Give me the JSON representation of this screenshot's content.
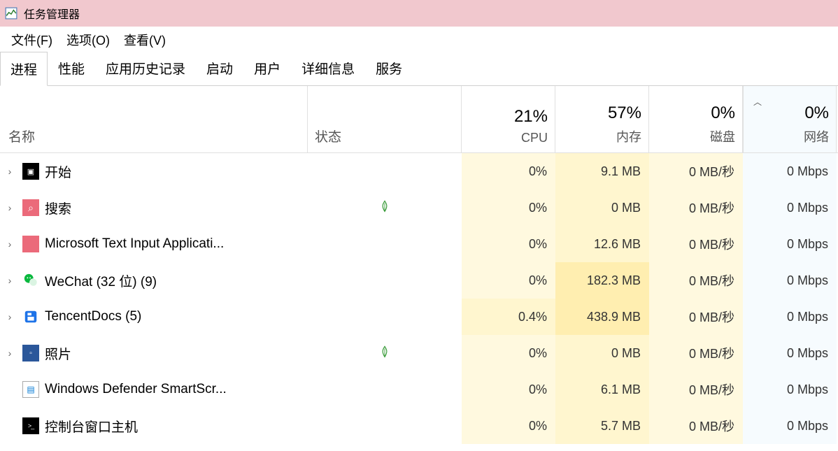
{
  "window": {
    "title": "任务管理器"
  },
  "menu": {
    "file": "文件(F)",
    "options": "选项(O)",
    "view": "查看(V)"
  },
  "tabs": {
    "processes": "进程",
    "performance": "性能",
    "app_history": "应用历史记录",
    "startup": "启动",
    "users": "用户",
    "details": "详细信息",
    "services": "服务"
  },
  "headers": {
    "name": "名称",
    "status": "状态",
    "cpu_pct": "21%",
    "cpu_label": "CPU",
    "mem_pct": "57%",
    "mem_label": "内存",
    "disk_pct": "0%",
    "disk_label": "磁盘",
    "net_pct": "0%",
    "net_label": "网络"
  },
  "rows": [
    {
      "expandable": true,
      "icon": "black",
      "name": "开始",
      "leaf": false,
      "cpu": "0%",
      "mem": "9.1 MB",
      "disk": "0 MB/秒",
      "net": "0 Mbps",
      "mem_shade": "shade-low"
    },
    {
      "expandable": true,
      "icon": "pink",
      "name": "搜索",
      "leaf": true,
      "cpu": "0%",
      "mem": "0 MB",
      "disk": "0 MB/秒",
      "net": "0 Mbps",
      "mem_shade": "shade-low"
    },
    {
      "expandable": true,
      "icon": "pink2",
      "name": "Microsoft Text Input Applicati...",
      "leaf": false,
      "cpu": "0%",
      "mem": "12.6 MB",
      "disk": "0 MB/秒",
      "net": "0 Mbps",
      "mem_shade": "shade-low"
    },
    {
      "expandable": true,
      "icon": "wechat",
      "name": "WeChat (32 位) (9)",
      "leaf": false,
      "cpu": "0%",
      "mem": "182.3 MB",
      "disk": "0 MB/秒",
      "net": "0 Mbps",
      "mem_shade": "shade-med"
    },
    {
      "expandable": true,
      "icon": "tencent",
      "name": "TencentDocs (5)",
      "leaf": false,
      "cpu": "0.4%",
      "mem": "438.9 MB",
      "disk": "0 MB/秒",
      "net": "0 Mbps",
      "mem_shade": "shade-med",
      "cpu_shade": "shade-low"
    },
    {
      "expandable": true,
      "icon": "blue",
      "name": "照片",
      "leaf": true,
      "cpu": "0%",
      "mem": "0 MB",
      "disk": "0 MB/秒",
      "net": "0 Mbps",
      "mem_shade": "shade-low"
    },
    {
      "expandable": false,
      "icon": "defender",
      "name": "Windows Defender SmartScr...",
      "leaf": false,
      "cpu": "0%",
      "mem": "6.1 MB",
      "disk": "0 MB/秒",
      "net": "0 Mbps",
      "mem_shade": "shade-low"
    },
    {
      "expandable": false,
      "icon": "console",
      "name": "控制台窗口主机",
      "leaf": false,
      "cpu": "0%",
      "mem": "5.7 MB",
      "disk": "0 MB/秒",
      "net": "0 Mbps",
      "mem_shade": "shade-low"
    }
  ]
}
